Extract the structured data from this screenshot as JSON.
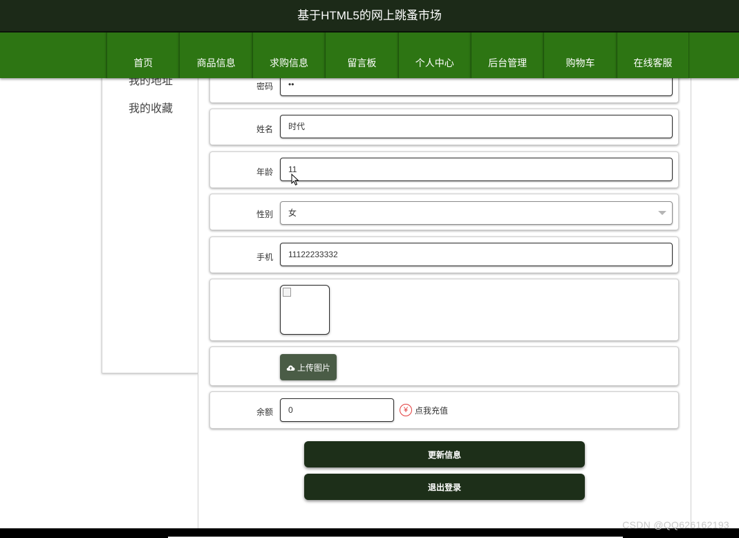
{
  "header": {
    "title": "基于HTML5的网上跳蚤市场"
  },
  "nav": {
    "items": [
      "首页",
      "商品信息",
      "求购信息",
      "留言板",
      "个人中心",
      "后台管理",
      "购物车",
      "在线客服"
    ]
  },
  "sidebar": {
    "items": [
      {
        "label": "我的地址"
      },
      {
        "label": "我的收藏"
      }
    ]
  },
  "form": {
    "password": {
      "label": "密码",
      "value": "••"
    },
    "name": {
      "label": "姓名",
      "value": "时代"
    },
    "age": {
      "label": "年龄",
      "value": "11"
    },
    "gender": {
      "label": "性别",
      "value": "女"
    },
    "phone": {
      "label": "手机",
      "value": "11122233332"
    },
    "upload_label": "上传图片",
    "balance": {
      "label": "余额",
      "value": "0"
    },
    "recharge_icon": "¥",
    "recharge_label": "点我充值"
  },
  "actions": {
    "update_label": "更新信息",
    "logout_label": "退出登录"
  },
  "watermark": "CSDN @QQ626162193",
  "colors": {
    "header_bg": "#1c2a18",
    "nav_bg": "#2d7513",
    "button_bg": "#1d2f19",
    "upload_bg": "#4a5c46",
    "recharge_red": "#e23b3b"
  }
}
